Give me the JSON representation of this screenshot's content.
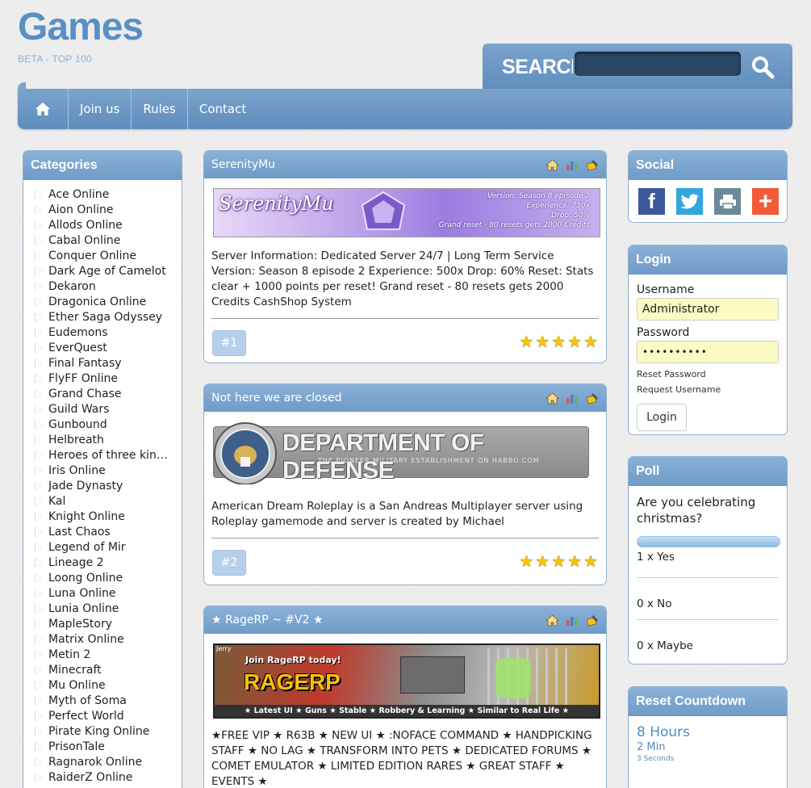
{
  "logo": {
    "title": "Games",
    "subtitle": "BETA - TOP 100"
  },
  "search": {
    "label": "SEARCH",
    "placeholder": ""
  },
  "nav": {
    "items": [
      "Join us",
      "Rules",
      "Contact"
    ]
  },
  "categories": {
    "title": "Categories",
    "items": [
      "Ace Online",
      "Aion Online",
      "Allods Online",
      "Cabal Online",
      "Conquer Online",
      "Dark Age of Camelot",
      "Dekaron",
      "Dragonica Online",
      "Ether Saga Odyssey",
      "Eudemons",
      "EverQuest",
      "Final Fantasy",
      "FlyFF Online",
      "Grand Chase",
      "Guild Wars",
      "Gunbound",
      "Helbreath",
      "Heroes of three kingd…",
      "Iris Online",
      "Jade Dynasty",
      "Kal",
      "Knight Online",
      "Last Chaos",
      "Legend of Mir",
      "Lineage 2",
      "Loong Online",
      "Luna Online",
      "Lunia Online",
      "MapleStory",
      "Matrix Online",
      "Metin 2",
      "Minecraft",
      "Mu Online",
      "Myth of Soma",
      "Perfect World",
      "Pirate King Online",
      "PrisonTale",
      "Ragnarok Online",
      "RaiderZ Online"
    ]
  },
  "servers": [
    {
      "name": "SerenityMu",
      "banner": {
        "title": "SerenityMu",
        "lines": [
          "Version: Season 8 episode 2",
          "Experience: 750x",
          "Drop: 50%",
          "Grand reset - 80 resets gets 2000 Credits"
        ]
      },
      "description": "Server Information: Dedicated Server 24/7 | Long Term Service Version: Season 8 episode 2 Experience: 500x Drop: 60% Reset: Stats clear + 1000 points per reset! Grand reset - 80 resets gets 2000 Credits CashShop System",
      "rank": "#1",
      "rating": 5
    },
    {
      "name": "Not here we are closed",
      "banner": {
        "title": "DEPARTMENT OF DEFENSE",
        "subtitle": "THE PIONEER MILITARY ESTABLISHMENT ON HABBO.COM"
      },
      "description": "American Dream Roleplay is a San Andreas Multiplayer server using Roleplay gamemode and server is created by Michael",
      "rank": "#2",
      "rating": 5
    },
    {
      "name": "★ RageRP ~ #V2 ★",
      "banner": {
        "title": "RAGERP",
        "top": "Join RageRP today!",
        "tag": "Jerry",
        "bottom": "★ Latest UI ★ Guns ★ Stable ★ Robbery & Learning ★ Similar to Real Life ★"
      },
      "description": "★FREE VIP ★ R63B ★ NEW UI ★ :NOFACE COMMAND ★ HANDPICKING STAFF ★ NO LAG ★ TRANSFORM INTO PETS ★ DEDICATED FORUMS ★ COMET EMULATOR ★ LIMITED EDITION RARES ★ GREAT STAFF ★ EVENTS ★"
    }
  ],
  "social": {
    "title": "Social",
    "icons": [
      "facebook-icon",
      "twitter-icon",
      "print-icon",
      "plus-icon"
    ]
  },
  "login": {
    "title": "Login",
    "username_label": "Username",
    "username_value": "Administrator",
    "password_label": "Password",
    "password_value": "••••••••••",
    "reset_password": "Reset Password",
    "request_username": "Request Username",
    "button": "Login"
  },
  "poll": {
    "title": "Poll",
    "question": "Are you celebrating christmas?",
    "yes_share": 1.0,
    "options": [
      "1 x Yes",
      "0 x No",
      "0 x Maybe"
    ]
  },
  "countdown": {
    "title": "Reset Countdown",
    "hours": "8 Hours",
    "minutes": "2 Min",
    "seconds": "3 Seconds"
  },
  "colors": {
    "accent": "#6e9bc8",
    "link": "#4e8dc7",
    "star": "#f3c512"
  }
}
